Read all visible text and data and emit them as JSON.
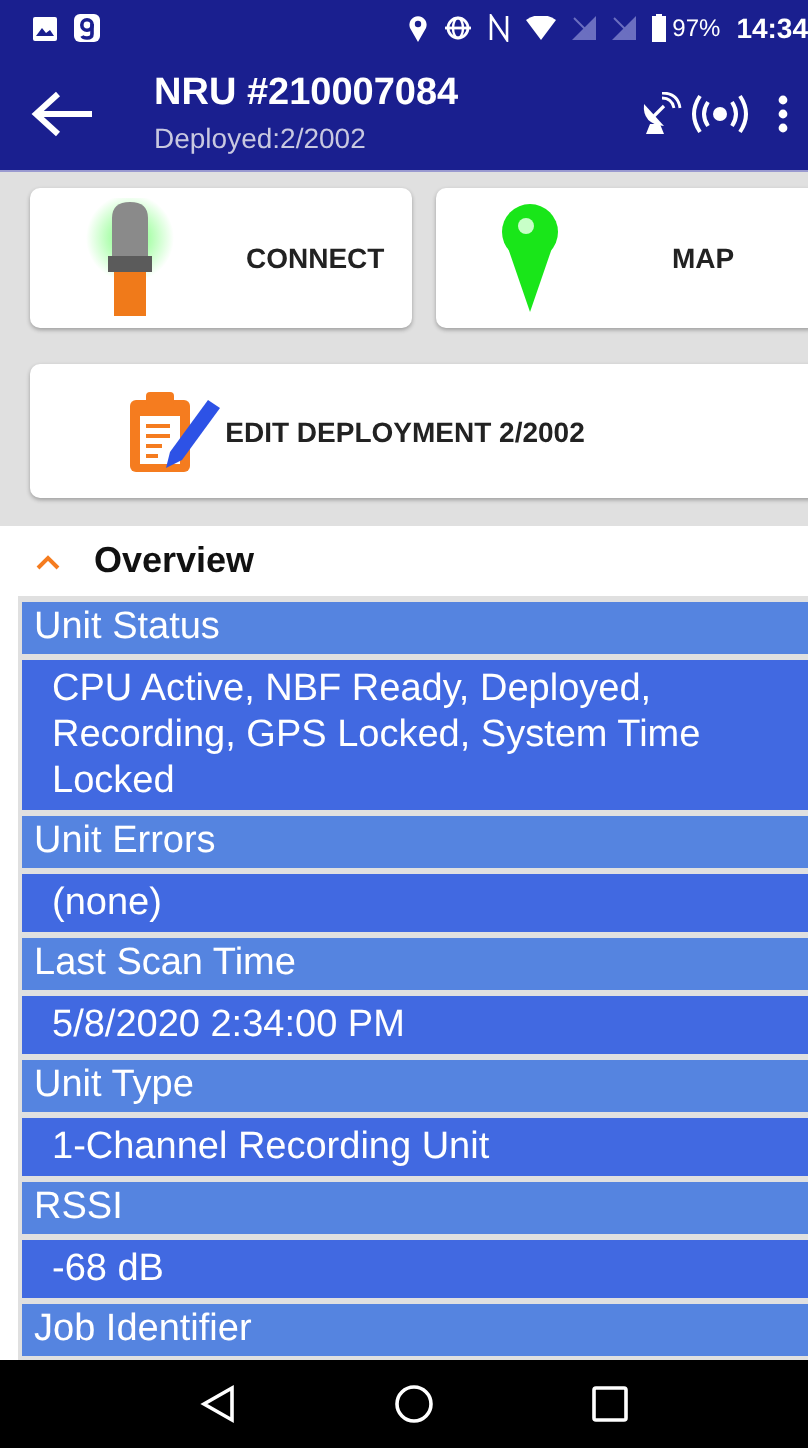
{
  "status_bar": {
    "battery": "97%",
    "time": "14:34"
  },
  "toolbar": {
    "title": "NRU #210007084",
    "subtitle": "Deployed:2/2002"
  },
  "actions": [
    {
      "kind": "connect",
      "label": "CONNECT"
    },
    {
      "kind": "map",
      "label": "MAP"
    },
    {
      "kind": "edit",
      "label": "EDIT DEPLOYMENT 2/2002"
    }
  ],
  "section": {
    "title": "Overview",
    "expanded": true
  },
  "fields": [
    {
      "label": "Unit Status",
      "value": "CPU Active, NBF Ready, Deployed, Recording, GPS Locked, System Time Locked"
    },
    {
      "label": "Unit Errors",
      "value": "(none)"
    },
    {
      "label": "Last Scan Time",
      "value": "5/8/2020 2:34:00 PM"
    },
    {
      "label": "Unit Type",
      "value": "1-Channel Recording Unit"
    },
    {
      "label": "RSSI",
      "value": "-68 dB"
    },
    {
      "label": "Job Identifier"
    }
  ]
}
